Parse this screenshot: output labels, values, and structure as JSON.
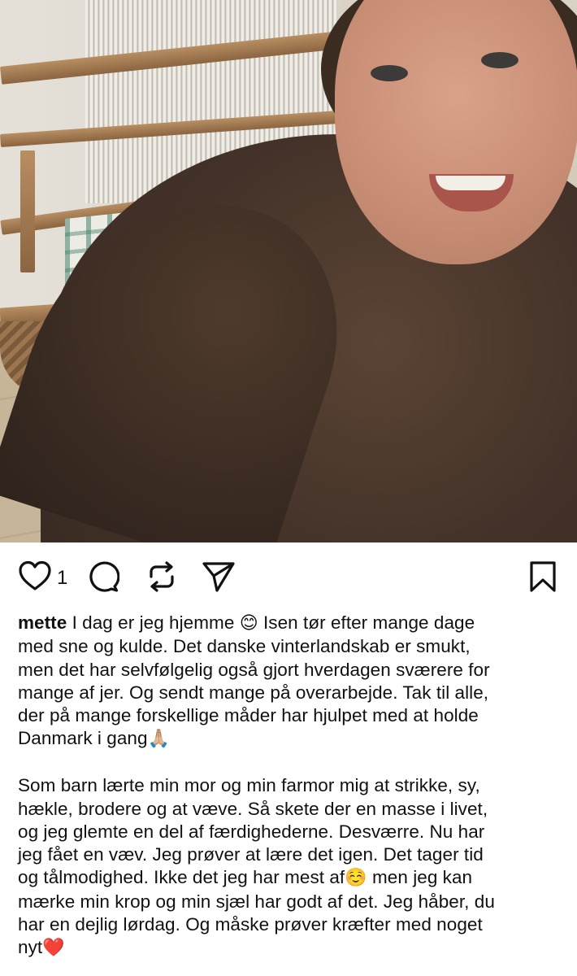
{
  "post": {
    "likes": {
      "count": "1"
    },
    "icons": {
      "like": "heart-icon",
      "comment": "comment-icon",
      "repost": "repost-icon",
      "share": "send-icon",
      "save": "bookmark-icon"
    },
    "caption": {
      "username": "mette",
      "para1_line1": " I dag er jeg hjemme ",
      "emoji_smile": "😊",
      "para1_line1b": " Isen tør efter mange dage",
      "para1_line2": "med sne og kulde. Det danske vinterlandskab er smukt,",
      "para1_line3": "men det har selvfølgelig også gjort hverdagen sværere for",
      "para1_line4": "mange af jer. Og sendt mange på overarbejde. Tak til alle,",
      "para1_line5": "der på mange forskellige måder har hjulpet med at holde",
      "para1_line6": "Danmark i gang",
      "emoji_pray": "🙏🏼",
      "para2_line1": "Som barn lærte min mor og min farmor mig at strikke, sy,",
      "para2_line2": "hækle, brodere og at væve. Så skete der en masse i livet,",
      "para2_line3": "og jeg glemte en del af færdighederne. Desværre. Nu har",
      "para2_line4": "jeg fået en væv. Jeg prøver at lære det igen. Det tager tid",
      "para2_line5": "og tålmodighed. Ikke det jeg har mest af",
      "emoji_blush": "☺️",
      "para2_line5b": " men jeg kan",
      "para2_line6": "mærke min krop og min sjæl har godt af det. Jeg håber, du",
      "para2_line7": "har en dejlig lørdag. Og måske prøver kræfter med noget",
      "para2_line8": "nyt",
      "emoji_heart": "❤️"
    }
  }
}
